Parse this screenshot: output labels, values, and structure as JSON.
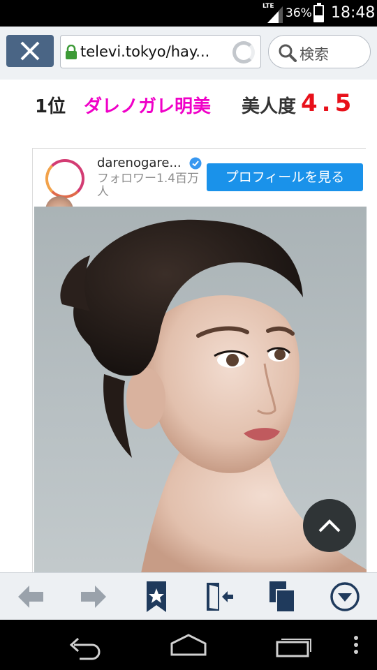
{
  "status_bar": {
    "network": "LTE",
    "battery_percent": "36%",
    "battery_level": 0.36,
    "time": "18:48"
  },
  "browser": {
    "url": "televi.tokyo/hay...",
    "search_placeholder": "検索",
    "load_progress": 0.89,
    "icons": {
      "close": "close-icon",
      "lock": "lock-icon",
      "loading": "loading-spinner-icon",
      "search": "search-icon"
    }
  },
  "ranking": {
    "rank": "1位",
    "name": "ダレノガレ明美",
    "beauty_label": "美人度",
    "beauty_score": "4.5"
  },
  "instagram_embed": {
    "username": "darenogare...",
    "followers": "フォロワー1.4百万人",
    "profile_button": "プロフィールを見る",
    "photo": "portrait-photo"
  },
  "colors": {
    "name": "#f000c8",
    "score": "#e8101a",
    "profile_button": "#1a92ea",
    "progress": "#35a8dd",
    "close_button": "#4a6585"
  },
  "toolbar": {
    "icons": [
      "back-arrow-icon",
      "forward-arrow-icon",
      "bookmark-icon",
      "exit-door-icon",
      "tabs-icon",
      "menu-down-icon"
    ]
  },
  "nav": {
    "icons": [
      "nav-back-icon",
      "nav-home-icon",
      "nav-recent-icon",
      "nav-menu-icon"
    ]
  }
}
